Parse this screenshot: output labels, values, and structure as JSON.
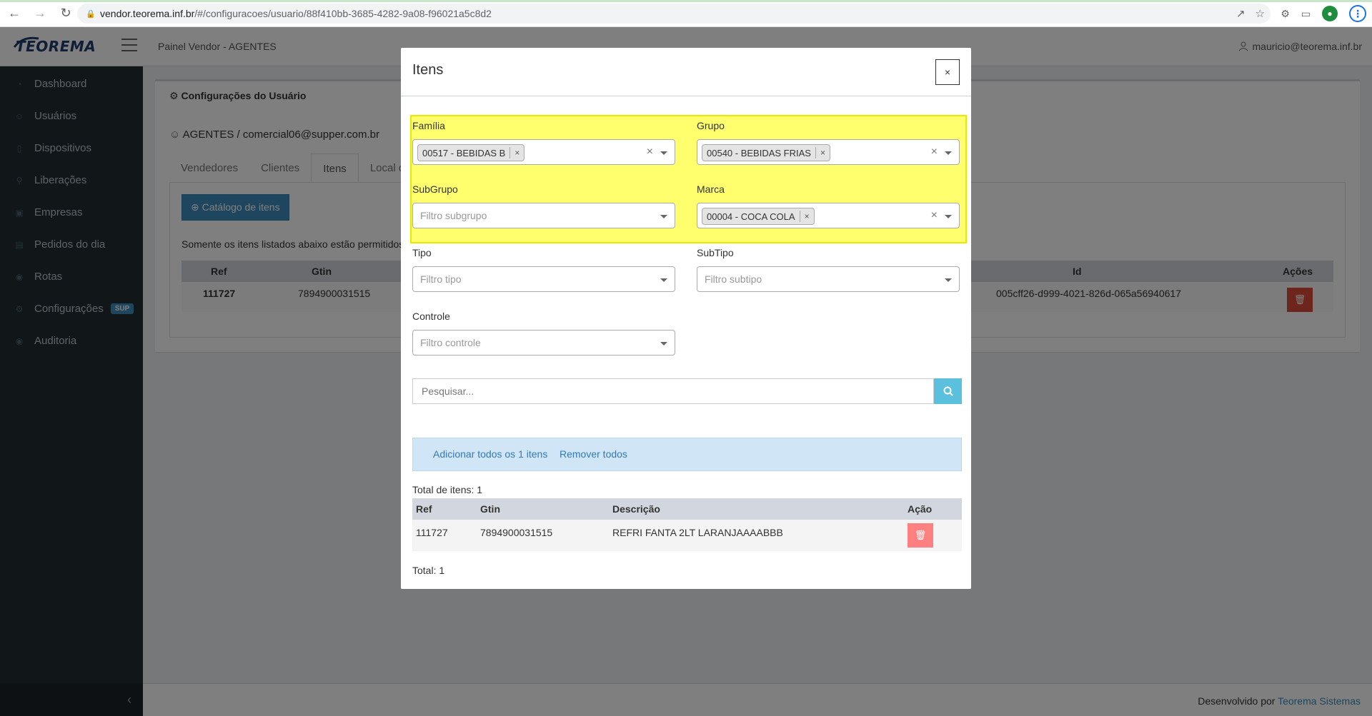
{
  "browser": {
    "url_host": "vendor.teorema.inf.br",
    "url_path": "/#/configuracoes/usuario/88f410bb-3685-4282-9a08-f96021a5c8d2"
  },
  "header": {
    "logo": "TEOREMA",
    "title": "Painel Vendor - AGENTES",
    "user_email": "mauricio@teorema.inf.br"
  },
  "sidebar": {
    "items": [
      {
        "label": "Dashboard",
        "icon": "dashboard-icon"
      },
      {
        "label": "Usuários",
        "icon": "users-icon"
      },
      {
        "label": "Dispositivos",
        "icon": "mobile-icon"
      },
      {
        "label": "Liberações",
        "icon": "key-icon"
      },
      {
        "label": "Empresas",
        "icon": "building-icon"
      },
      {
        "label": "Pedidos do dia",
        "icon": "cart-icon"
      },
      {
        "label": "Rotas",
        "icon": "map-marker-icon"
      },
      {
        "label": "Configurações",
        "icon": "gear-icon",
        "badge": "SUP"
      },
      {
        "label": "Auditoria",
        "icon": "eye-icon"
      }
    ]
  },
  "main": {
    "box_title": "Configurações do Usuário",
    "user_line": "AGENTES / comercial06@supper.com.br",
    "tabs": [
      "Vendedores",
      "Clientes",
      "Itens",
      "Local de"
    ],
    "catalog_button": "Catálogo de itens",
    "note": "Somente os itens listados abaixo estão permitidos",
    "table": {
      "headers": [
        "Ref",
        "Gtin",
        "Id",
        "Ações"
      ],
      "row": {
        "ref": "111727",
        "gtin": "7894900031515",
        "id": "005cff26-d999-4021-826d-065a56940617"
      }
    }
  },
  "footer": {
    "prefix": "Desenvolvido por",
    "link": "Teorema Sistemas"
  },
  "modal": {
    "title": "Itens",
    "close": "×",
    "fields": {
      "familia": {
        "label": "Família",
        "chip": "00517 - BEBIDAS B"
      },
      "grupo": {
        "label": "Grupo",
        "chip": "00540 - BEBIDAS FRIAS"
      },
      "subgrupo": {
        "label": "SubGrupo",
        "placeholder": "Filtro subgrupo"
      },
      "marca": {
        "label": "Marca",
        "chip": "00004 - COCA COLA"
      },
      "tipo": {
        "label": "Tipo",
        "placeholder": "Filtro tipo"
      },
      "subtipo": {
        "label": "SubTipo",
        "placeholder": "Filtro subtipo"
      },
      "controle": {
        "label": "Controle",
        "placeholder": "Filtro controle"
      }
    },
    "search_placeholder": "Pesquisar...",
    "add_all": "Adicionar todos os 1 itens",
    "remove_all": "Remover todos",
    "total_items": "Total de itens: 1",
    "table": {
      "headers": [
        "Ref",
        "Gtin",
        "Descrição",
        "Ação"
      ],
      "row": {
        "ref": "111727",
        "gtin": "7894900031515",
        "descricao": "REFRI FANTA 2LT LARANJAAAABBB"
      }
    },
    "total": "Total: 1"
  },
  "colors": {
    "highlight": "#ffff6e",
    "primary": "#3c8dbc",
    "danger": "#dd4b39",
    "sidebar": "#222d32"
  }
}
